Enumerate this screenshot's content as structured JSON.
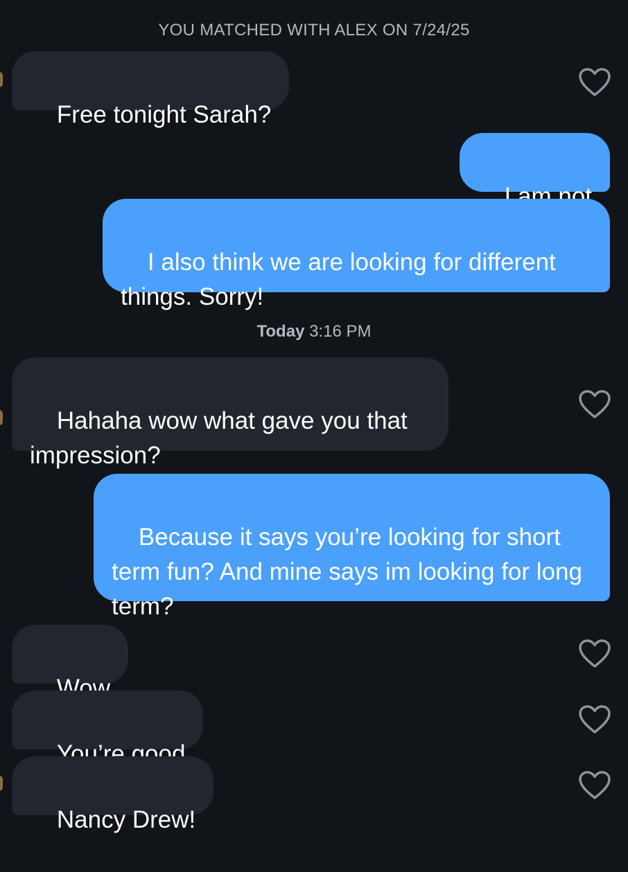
{
  "chat": {
    "match_header": "YOU MATCHED WITH ALEX ON 7/24/25",
    "timestamp": {
      "day": "Today",
      "time": "3:16 PM"
    },
    "messages": [
      {
        "from": "them",
        "text": "Free tonight Sarah?"
      },
      {
        "from": "me",
        "text": "I am not"
      },
      {
        "from": "me",
        "text": "I also think we are looking for different things. Sorry!"
      },
      {
        "from": "them",
        "text": "Hahaha wow what gave you that impression?"
      },
      {
        "from": "me",
        "text": "Because it says you’re looking for short term fun? And mine says im looking for long term?"
      },
      {
        "from": "them",
        "text": "Wow"
      },
      {
        "from": "them",
        "text": "You’re good"
      },
      {
        "from": "them",
        "text": "Nancy Drew!"
      }
    ]
  },
  "icons": {
    "like": "heart-outline-icon"
  },
  "colors": {
    "background": "#111418",
    "incoming_bubble": "#22262e",
    "outgoing_bubble": "#4aa0fb",
    "muted_text": "#b4b8bf",
    "heart_outline": "#8e939b"
  }
}
